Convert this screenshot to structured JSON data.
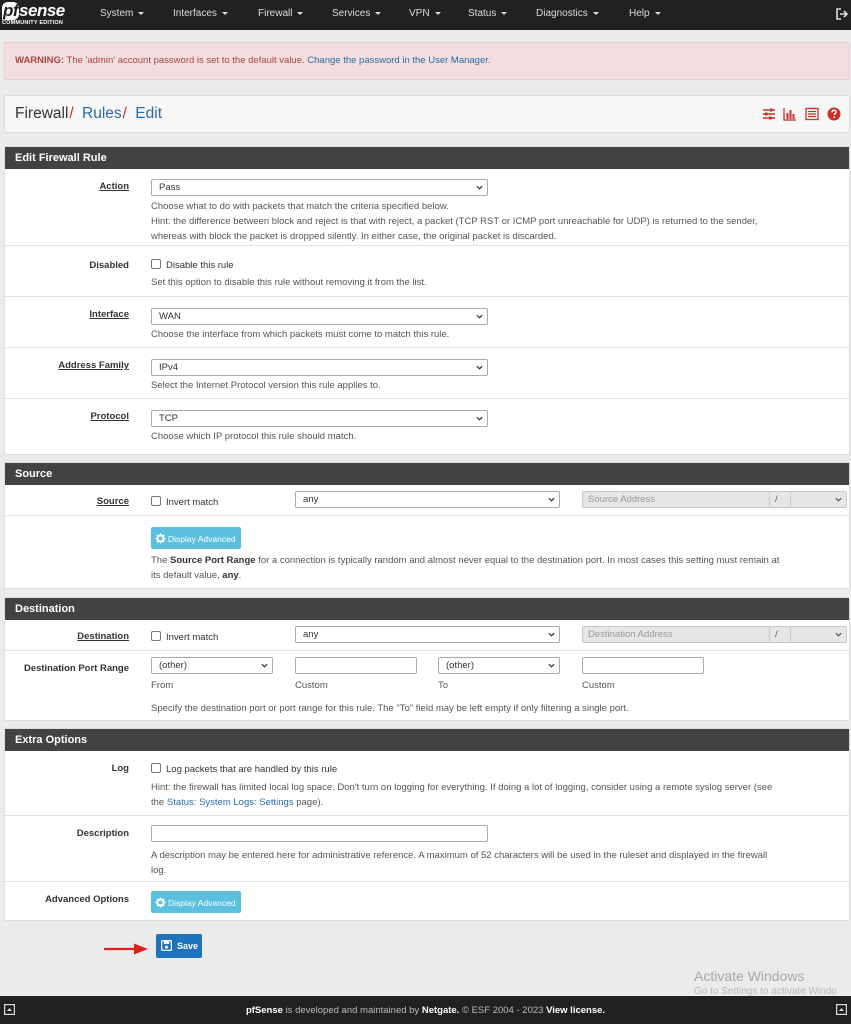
{
  "nav": {
    "logo_text": "pfsense",
    "logo_sub": "COMMUNITY EDITION",
    "items": [
      "System",
      "Interfaces",
      "Firewall",
      "Services",
      "VPN",
      "Status",
      "Diagnostics",
      "Help"
    ]
  },
  "warning": {
    "label": "WARNING:",
    "text": "The 'admin' account password is set to the default value.",
    "link": "Change the password in the User Manager."
  },
  "breadcrumb": {
    "root": "Firewall",
    "rules": "Rules",
    "edit": "Edit",
    "sep": "/"
  },
  "edit_rule": {
    "title": "Edit Firewall Rule",
    "action_label": "Action",
    "action_value": "Pass",
    "action_help1": "Choose what to do with packets that match the criteria specified below.",
    "action_help2": "Hint: the difference between block and reject is that with reject, a packet (TCP RST or ICMP port unreachable for UDP) is returned to the sender,",
    "action_help3": "whereas with block the packet is dropped silently. In either case, the original packet is discarded.",
    "disabled_label": "Disabled",
    "disabled_check": "Disable this rule",
    "disabled_help": "Set this option to disable this rule without removing it from the list.",
    "interface_label": "Interface",
    "interface_value": "WAN",
    "interface_help": "Choose the interface from which packets must come to match this rule.",
    "family_label": "Address Family",
    "family_value": "IPv4",
    "family_help": "Select the Internet Protocol version this rule applies to.",
    "protocol_label": "Protocol",
    "protocol_value": "TCP",
    "protocol_help": "Choose which IP protocol this rule should match."
  },
  "source": {
    "title": "Source",
    "label": "Source",
    "invert": "Invert match",
    "type_value": "any",
    "address_placeholder": "Source Address",
    "slash": "/",
    "adv_button": "Display Advanced",
    "help_pre": "The",
    "help_bold": "Source Port Range",
    "help_mid": "for a connection is typically random and almost never equal to the destination port. In most cases this setting must remain at",
    "help_line2_pre": "its default value,",
    "help_bold2": "any",
    "help_end": "."
  },
  "destination": {
    "title": "Destination",
    "label": "Destination",
    "invert": "Invert match",
    "type_value": "any",
    "address_placeholder": "Destination Address",
    "slash": "/",
    "port_label": "Destination Port Range",
    "from_value": "(other)",
    "to_value": "(other)",
    "from_caption": "From",
    "custom_caption": "Custom",
    "to_caption": "To",
    "custom_caption2": "Custom",
    "port_help": "Specify the destination port or port range for this rule. The \"To\" field may be left empty if only filtering a single port."
  },
  "extra": {
    "title": "Extra Options",
    "log_label": "Log",
    "log_check": "Log packets that are handled by this rule",
    "log_help1": "Hint: the firewall has limited local log space. Don't turn on logging for everything. If doing a lot of logging, consider using a remote syslog server (see",
    "log_help2_pre": "the",
    "log_help2_link": "Status: System Logs: Settings",
    "log_help2_post": "page).",
    "desc_label": "Description",
    "desc_help1": "A description may be entered here for administrative reference. A maximum of 52 characters will be used in the ruleset and displayed in the firewall",
    "desc_help2": "log.",
    "adv_label": "Advanced Options",
    "adv_button": "Display Advanced"
  },
  "save_button": "Save",
  "watermark": {
    "line1": "Activate Windows",
    "line2": "Go to Settings to activate Windo"
  },
  "footer": {
    "brand": "pfSense",
    "text1": "is developed and maintained by",
    "company": "Netgate.",
    "text2": "© ESF 2004 - 2023",
    "license": "View license."
  },
  "colors": {
    "nav_bg": "#212121",
    "panel_head": "#424242",
    "link": "#2a6ba5",
    "accent_red": "#c9302c",
    "info_button": "#5bc0de",
    "primary_button": "#1e73be",
    "warning_bg": "#f2dede"
  }
}
